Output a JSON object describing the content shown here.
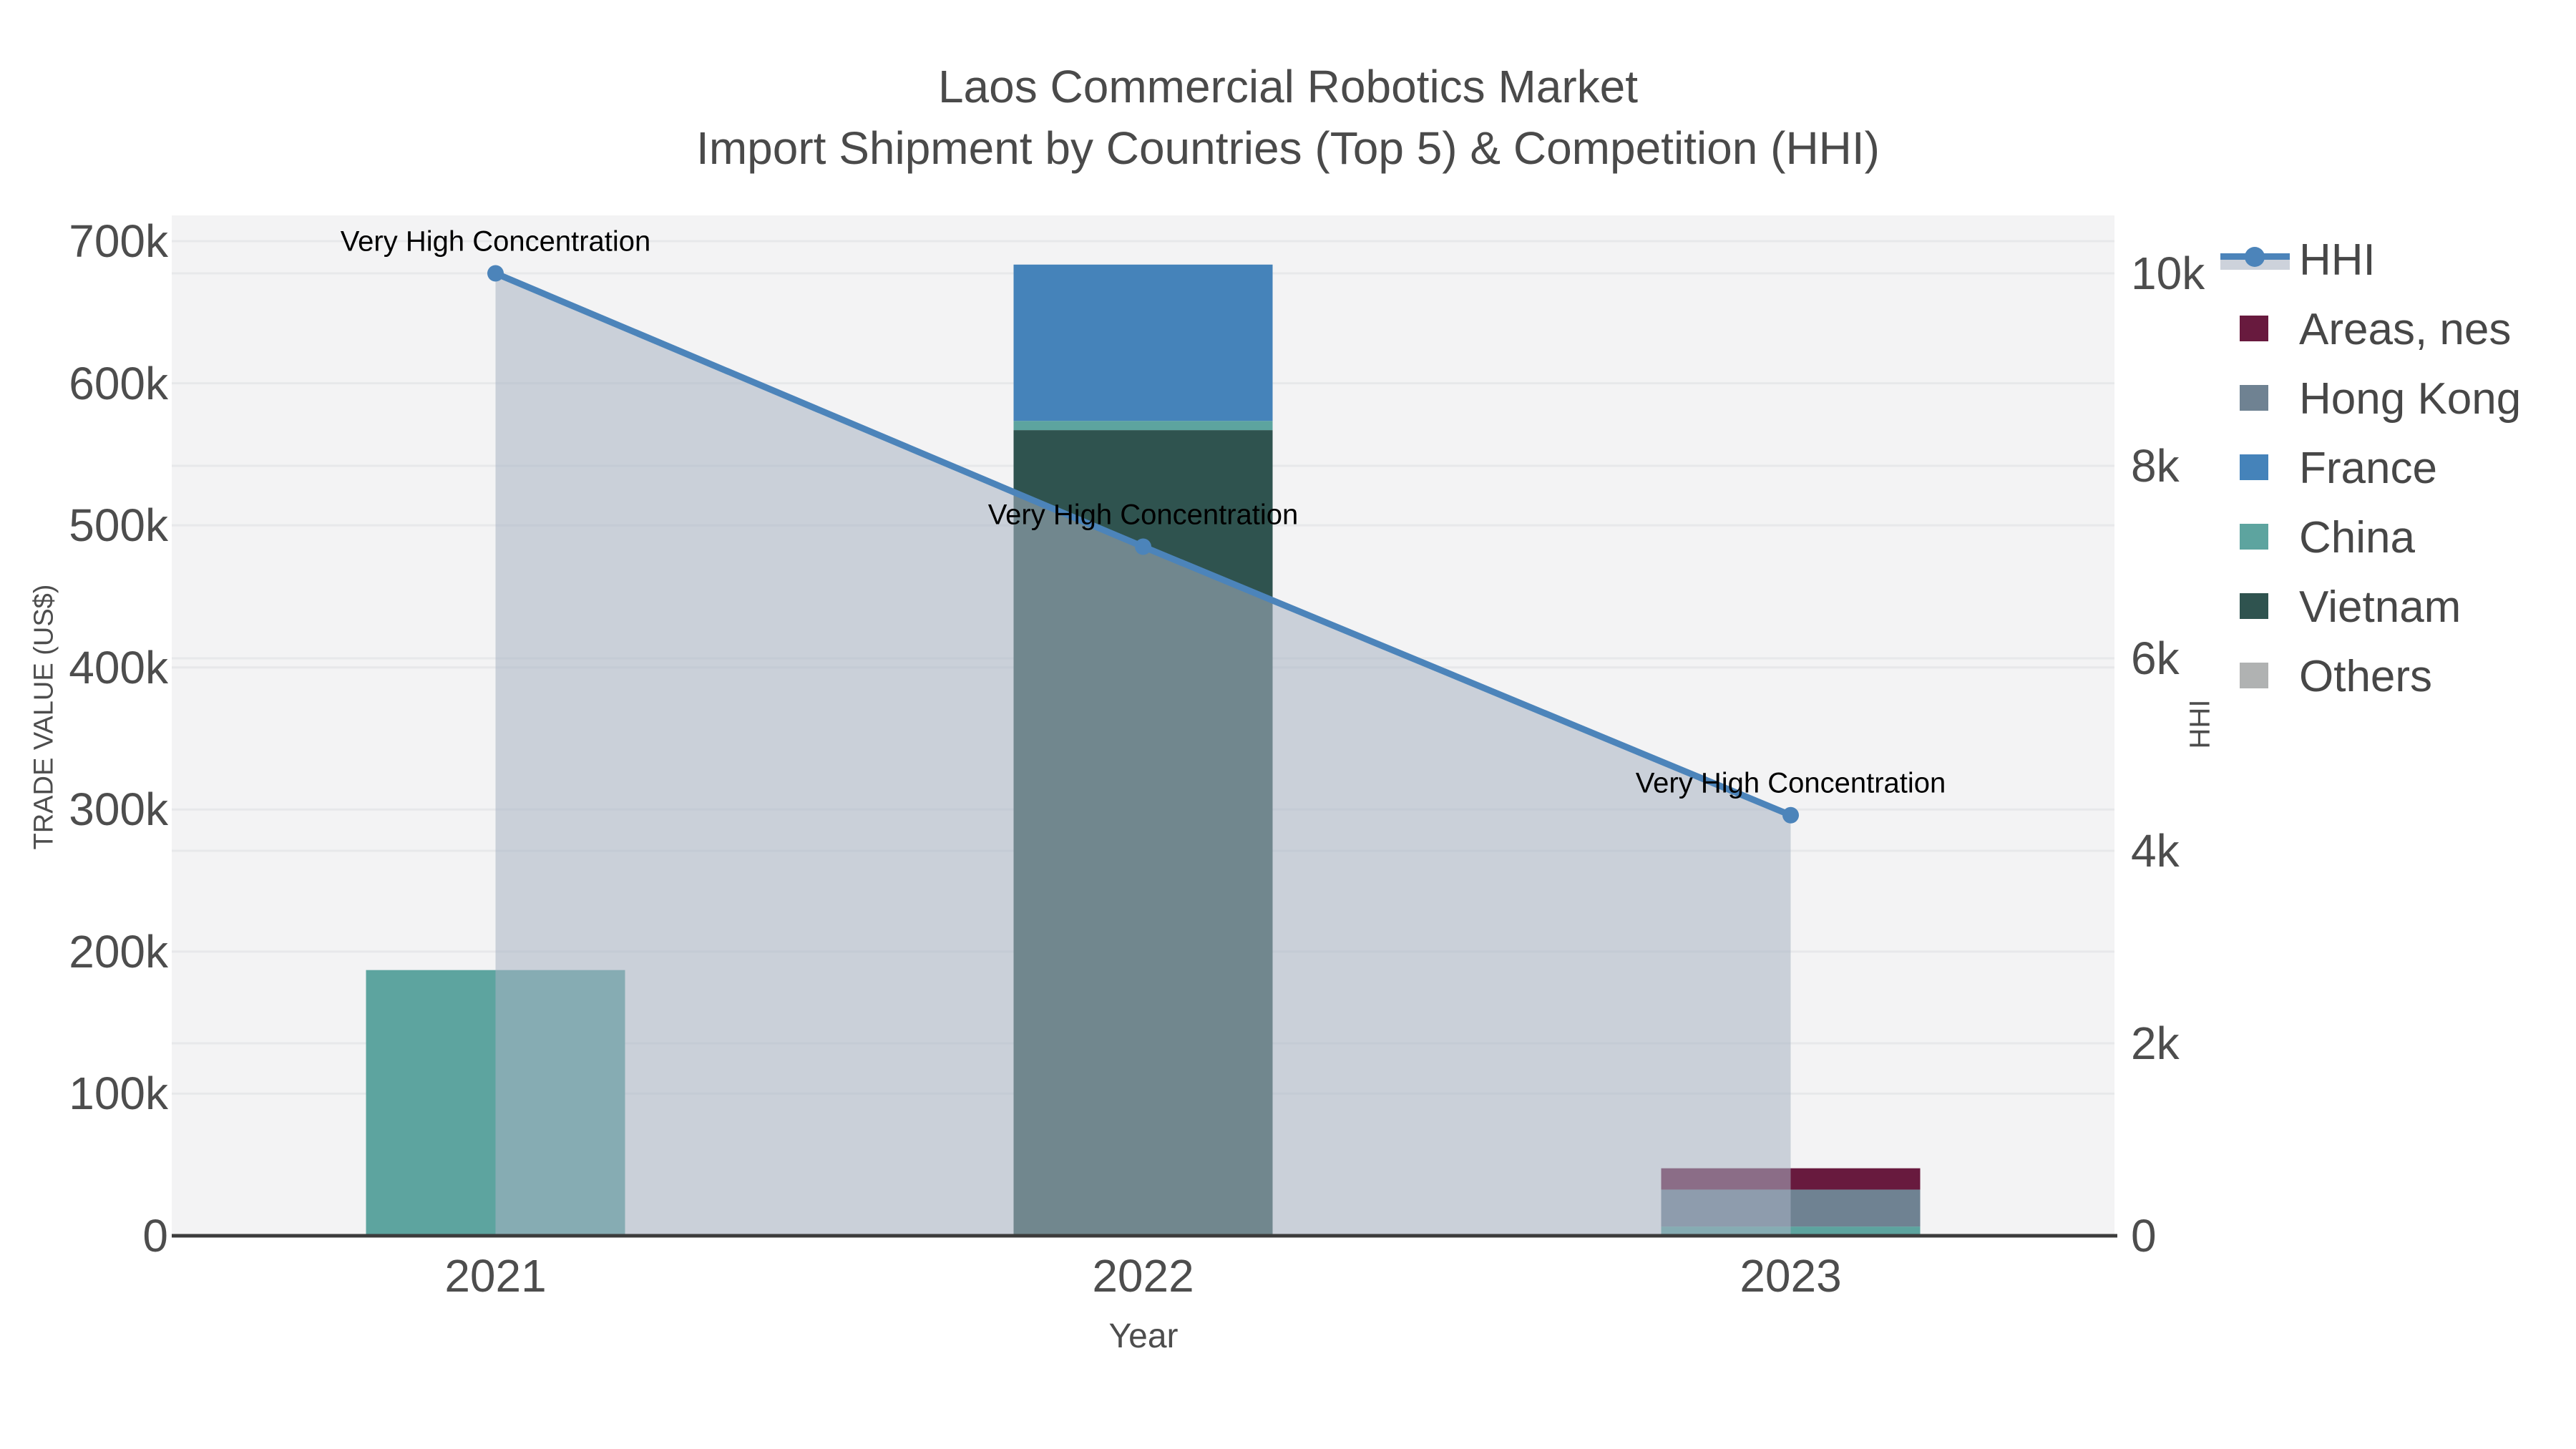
{
  "title": {
    "line1": "Laos Commercial Robotics Market",
    "line2": "Import Shipment by Countries (Top 5) & Competition (HHI)"
  },
  "axes": {
    "x": {
      "title": "Year",
      "ticks": [
        "2021",
        "2022",
        "2023"
      ]
    },
    "y_left": {
      "title": "TRADE VALUE (US$)",
      "ticks": [
        "0",
        "100k",
        "200k",
        "300k",
        "400k",
        "500k",
        "600k",
        "700k"
      ]
    },
    "y_right": {
      "title": "HHI",
      "ticks": [
        "0",
        "2k",
        "4k",
        "6k",
        "8k",
        "10k"
      ]
    }
  },
  "legend": {
    "items": [
      {
        "label": "HHI",
        "type": "line",
        "color": "#4c84ba",
        "band_color": "#cdd2db"
      },
      {
        "label": "Areas, nes",
        "type": "square",
        "color": "#681a3e"
      },
      {
        "label": "Hong Kong",
        "type": "square",
        "color": "#6f8292"
      },
      {
        "label": "France",
        "type": "square",
        "color": "#4583ba"
      },
      {
        "label": "China",
        "type": "square",
        "color": "#5da49f"
      },
      {
        "label": "Vietnam",
        "type": "square",
        "color": "#2f534f"
      },
      {
        "label": "Others",
        "type": "square",
        "color": "#b0b2b2"
      }
    ]
  },
  "colors": {
    "plot_bg": "#f3f3f4",
    "gridline": "#e7e8ea",
    "axis_line": "#3c3c3c",
    "hhi_line": "#4c84ba",
    "area_fill": "rgba(168,178,195,0.55)"
  },
  "chart_data": {
    "type": "bar",
    "subtype": "stacked bars (left axis) + HHI line with area fill (right axis)",
    "categories": [
      "2021",
      "2022",
      "2023"
    ],
    "series": [
      {
        "name": "Others",
        "color": "#b0b2b2",
        "values": [
          0,
          0,
          0
        ]
      },
      {
        "name": "Vietnam",
        "color": "#2f534f",
        "values": [
          0,
          567000,
          0
        ]
      },
      {
        "name": "China",
        "color": "#5da49f",
        "values": [
          187000,
          6500,
          6500
        ]
      },
      {
        "name": "France",
        "color": "#4583ba",
        "values": [
          0,
          110000,
          0
        ]
      },
      {
        "name": "Hong Kong",
        "color": "#6f8292",
        "values": [
          0,
          0,
          26000
        ]
      },
      {
        "name": "Areas, nes",
        "color": "#681a3e",
        "values": [
          0,
          0,
          15000
        ]
      }
    ],
    "line_series": {
      "name": "HHI",
      "axis": "right",
      "values": [
        10000,
        7160,
        4370
      ]
    },
    "annotations": [
      {
        "text": "Very High Concentration",
        "x_index": 0,
        "hhi": 10000
      },
      {
        "text": "Very High Concentration",
        "x_index": 1,
        "hhi": 7160
      },
      {
        "text": "Very High Concentration",
        "x_index": 2,
        "hhi": 4370
      }
    ],
    "title": "Laos Commercial Robotics Market — Import Shipment by Countries (Top 5) & Competition (HHI)",
    "xlabel": "Year",
    "ylabel_left": "TRADE VALUE (US$)",
    "ylabel_right": "HHI",
    "ylim_left": [
      0,
      700000
    ],
    "ylim_right": [
      0,
      10000
    ],
    "grid": true,
    "legend_position": "right"
  }
}
